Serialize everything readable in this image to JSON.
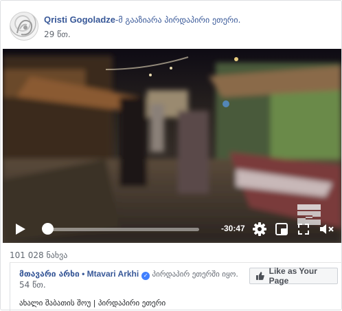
{
  "post": {
    "author": "Qristi Gogoladze",
    "action": "-მ გააზიარა პირდაპირი ეთერი.",
    "time": "29 წთ."
  },
  "video": {
    "remaining_time": "-30:47"
  },
  "views": "101 028 ნახვა",
  "shared": {
    "page_name_ka": "მთავარი არხი",
    "separator": " • ",
    "page_name_en": "Mtavari Arkhi",
    "status": " პირდაპირ ეთერში იყო.",
    "time": "54 წთ.",
    "like_page_label": "Like as Your Page",
    "description": "ახალი შაბათის შოუ | პირდაპირი ეთერი"
  },
  "colors": {
    "link": "#385898",
    "meta": "#616770",
    "verified": "#4080ff"
  },
  "icons": [
    "play-icon",
    "gear-icon",
    "picture-in-picture-icon",
    "fullscreen-icon",
    "muted-speaker-icon",
    "verified-badge-icon",
    "thumbs-up-icon",
    "more-options-icon"
  ]
}
